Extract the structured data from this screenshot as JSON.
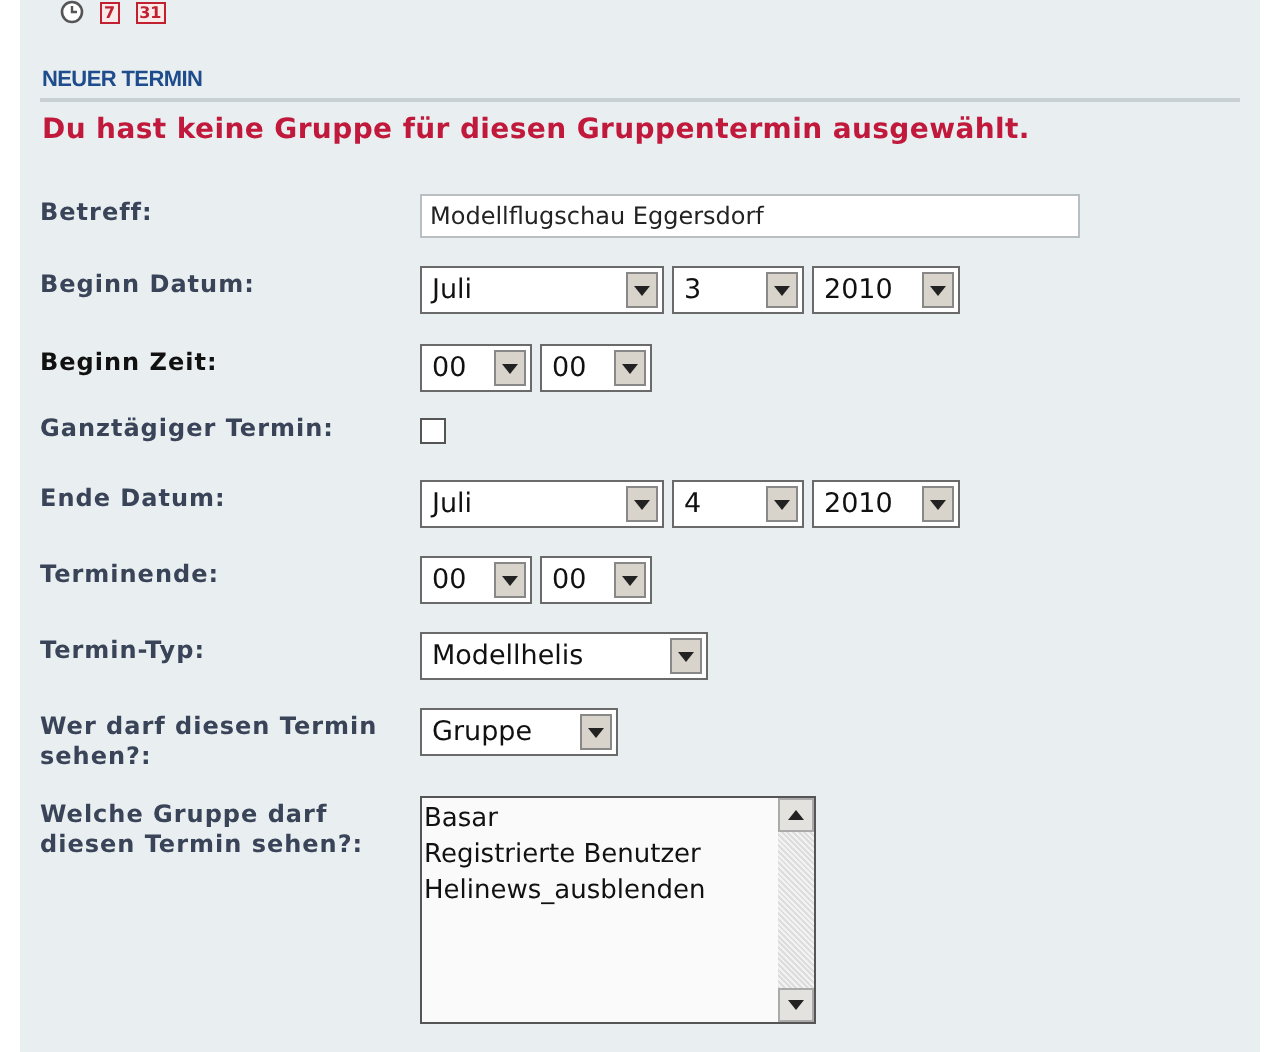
{
  "toolbar": [
    {
      "kind": "clock"
    },
    {
      "kind": "calendar",
      "label": "7"
    },
    {
      "kind": "calendar",
      "label": "31"
    }
  ],
  "section_title": "NEUER TERMIN",
  "error_message": "Du hast keine Gruppe für diesen Gruppentermin ausgewählt.",
  "fields": [
    {
      "label": "Betreff:",
      "highlighted": false,
      "kind": "text",
      "value": "Modellflugschau Eggersdorf"
    },
    {
      "label": "Beginn Datum:",
      "highlighted": false,
      "kind": "selects",
      "selects": [
        {
          "value": "Juli"
        },
        {
          "value": "3"
        },
        {
          "value": "2010"
        }
      ]
    },
    {
      "label": "Beginn Zeit:",
      "highlighted": true,
      "kind": "selects",
      "selects": [
        {
          "value": "00"
        },
        {
          "value": "00"
        }
      ]
    },
    {
      "label": "Ganztägiger Termin:",
      "highlighted": false,
      "kind": "checkbox",
      "checked": false
    },
    {
      "label": "Ende Datum:",
      "highlighted": false,
      "kind": "selects",
      "selects": [
        {
          "value": "Juli"
        },
        {
          "value": "4"
        },
        {
          "value": "2010"
        }
      ]
    },
    {
      "label": "Terminende:",
      "highlighted": false,
      "kind": "selects",
      "selects": [
        {
          "value": "00"
        },
        {
          "value": "00"
        }
      ]
    },
    {
      "label": "Termin-Typ:",
      "highlighted": false,
      "kind": "selects",
      "selects": [
        {
          "value": "Modellhelis"
        }
      ]
    },
    {
      "label": "Wer darf diesen Termin sehen?:",
      "highlighted": false,
      "kind": "selects",
      "selects": [
        {
          "value": "Gruppe"
        }
      ]
    },
    {
      "label": "Welche Gruppe darf diesen Termin sehen?:",
      "highlighted": false,
      "kind": "listbox",
      "options": [
        "Basar",
        "Registrierte Benutzer",
        "Helinews_ausblenden"
      ]
    }
  ]
}
